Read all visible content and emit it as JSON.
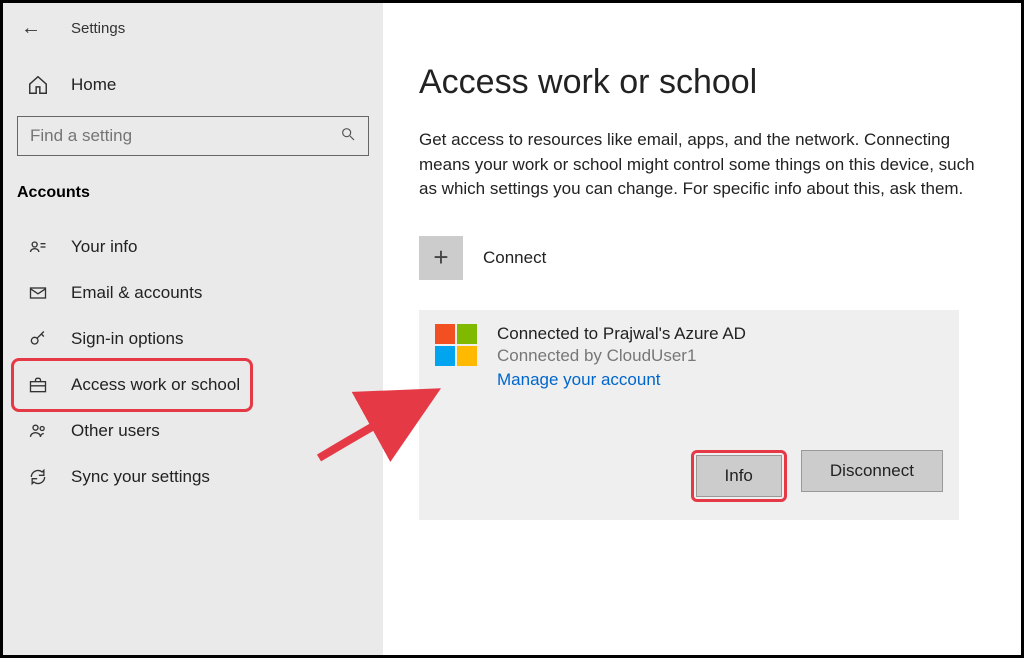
{
  "header": {
    "title": "Settings"
  },
  "nav": {
    "home": "Home",
    "search_placeholder": "Find a setting",
    "section": "Accounts",
    "items": [
      {
        "label": "Your info"
      },
      {
        "label": "Email & accounts"
      },
      {
        "label": "Sign-in options"
      },
      {
        "label": "Access work or school"
      },
      {
        "label": "Other users"
      },
      {
        "label": "Sync your settings"
      }
    ]
  },
  "main": {
    "title": "Access work or school",
    "description": "Get access to resources like email, apps, and the network. Connecting means your work or school might control some things on this device, such as which settings you can change. For specific info about this, ask them.",
    "connect_label": "Connect",
    "account": {
      "title": "Connected to Prajwal's Azure AD",
      "subtitle_prefix": "Connected by CloudUser1",
      "manage_link": "Manage your account",
      "info_button": "Info",
      "disconnect_button": "Disconnect"
    }
  },
  "annotations": {
    "highlight_nav_index": 3,
    "highlight_info_button": true,
    "arrow_color": "#e63946"
  }
}
